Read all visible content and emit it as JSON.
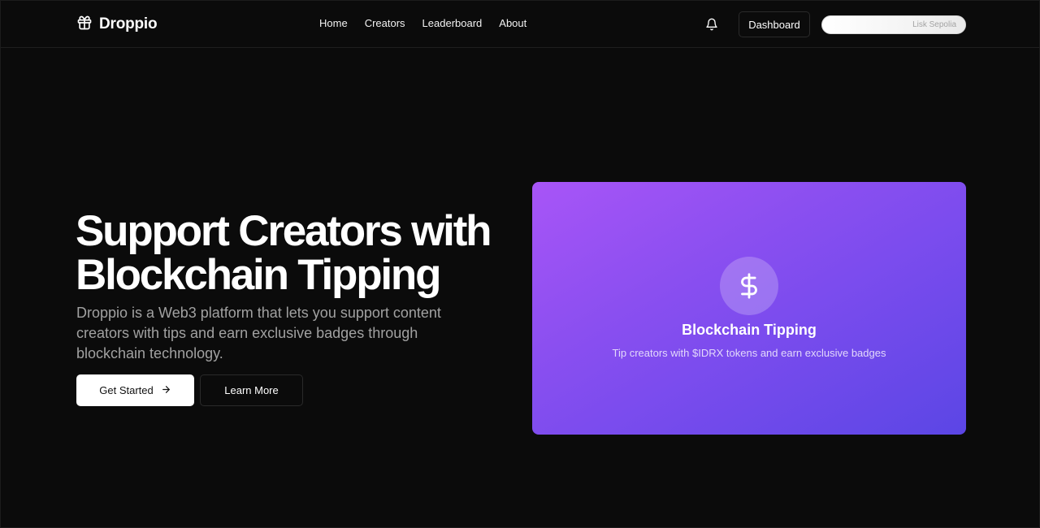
{
  "header": {
    "brand": "Droppio",
    "nav": [
      "Home",
      "Creators",
      "Leaderboard",
      "About"
    ],
    "dashboard_label": "Dashboard",
    "network_label": "Lisk Sepolia"
  },
  "hero": {
    "title_line1": "Support Creators with",
    "title_line2": "Blockchain Tipping",
    "description": "Droppio is a Web3 platform that lets you support content creators with tips and earn exclusive badges through blockchain technology.",
    "primary_cta": "Get Started",
    "secondary_cta": "Learn More"
  },
  "feature_card": {
    "icon": "dollar-icon",
    "title": "Blockchain Tipping",
    "subtitle": "Tip creators with $IDRX tokens and earn exclusive badges"
  },
  "colors": {
    "background": "#0b0b0b",
    "card_gradient_start": "#a855f7",
    "card_gradient_end": "#5b46e5"
  },
  "icons": {
    "brand": "gift-icon",
    "notifications": "bell-icon",
    "cta_arrow": "arrow-right-icon"
  }
}
